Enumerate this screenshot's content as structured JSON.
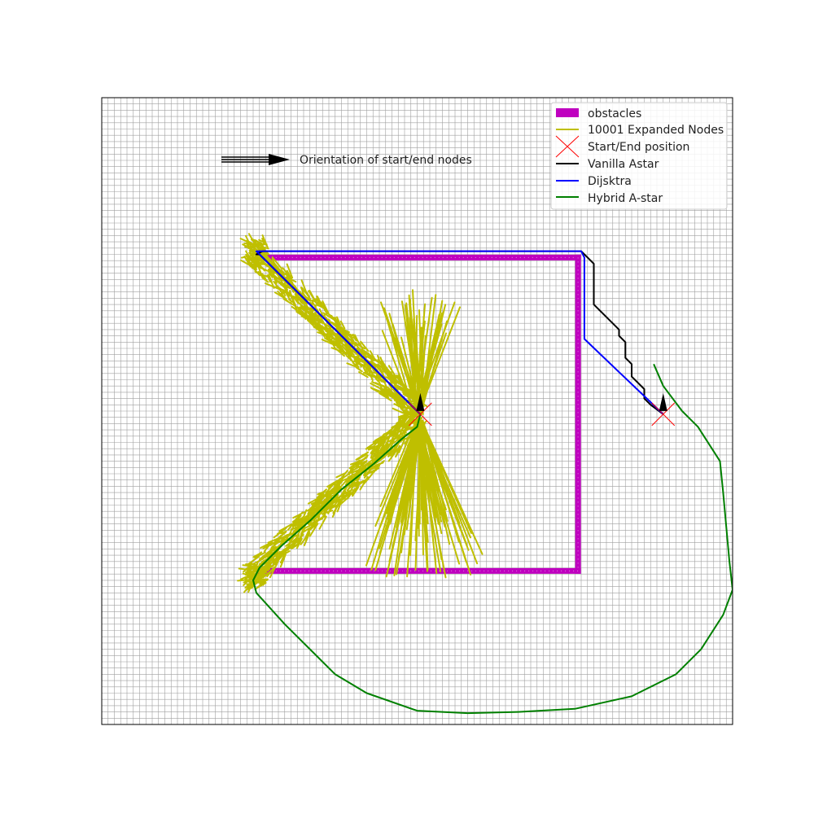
{
  "chart_data": {
    "type": "line",
    "title": "",
    "xlabel": "",
    "ylabel": "",
    "xlim": [
      0,
      100
    ],
    "ylim": [
      0,
      100
    ],
    "grid": true,
    "grid_color": "#a0a0a0",
    "grid_step": 1,
    "legend_position": "top-right",
    "annotation": {
      "text": "Orientation of start/end nodes"
    },
    "start": [
      50.5,
      49.5
    ],
    "end": [
      89,
      49.5
    ],
    "obstacles": [
      [
        [
          25,
          74.5
        ],
        [
          75.5,
          74.5
        ]
      ],
      [
        [
          75.5,
          74.5
        ],
        [
          75.5,
          24.5
        ]
      ],
      [
        [
          75.5,
          24.5
        ],
        [
          25,
          24.5
        ]
      ]
    ],
    "series": [
      {
        "name": "obstacles",
        "color": "#bf00bf",
        "kind": "obstacle"
      },
      {
        "name": "10001 Expanded Nodes",
        "color": "#bfbf00",
        "kind": "expanded"
      },
      {
        "name": "Start/End position",
        "color": "#ff0000",
        "kind": "marker"
      },
      {
        "name": "Vanilla Astar",
        "color": "#000000",
        "kind": "line",
        "points": [
          [
            50.5,
            49.5
          ],
          [
            25,
            75
          ],
          [
            24.5,
            75
          ],
          [
            25.5,
            75.5
          ],
          [
            76,
            75.5
          ],
          [
            78,
            73.5
          ],
          [
            78,
            67
          ],
          [
            82,
            63
          ],
          [
            82,
            62
          ],
          [
            83,
            61
          ],
          [
            83,
            58.5
          ],
          [
            84,
            57.5
          ],
          [
            84,
            55.5
          ],
          [
            86,
            53.5
          ],
          [
            86,
            52
          ],
          [
            87,
            51
          ],
          [
            89,
            49.5
          ]
        ]
      },
      {
        "name": "Dijsktra",
        "color": "#0000ff",
        "kind": "line",
        "points": [
          [
            50.5,
            49.5
          ],
          [
            24.5,
            75.5
          ],
          [
            25.5,
            75.5
          ],
          [
            76,
            75.5
          ],
          [
            76.5,
            74.5
          ],
          [
            76.5,
            61.5
          ],
          [
            89,
            49.5
          ]
        ]
      },
      {
        "name": "Hybrid A-star",
        "color": "#008000",
        "kind": "line",
        "points": [
          [
            50.5,
            49.5
          ],
          [
            50,
            47.5
          ],
          [
            47.5,
            45.5
          ],
          [
            43,
            41.5
          ],
          [
            38,
            37.5
          ],
          [
            33,
            32.5
          ],
          [
            28.5,
            28.5
          ],
          [
            25,
            25
          ],
          [
            24,
            23
          ],
          [
            24.5,
            21
          ],
          [
            29,
            16
          ],
          [
            37,
            8
          ],
          [
            42,
            5
          ],
          [
            50,
            2.2
          ],
          [
            58,
            1.8
          ],
          [
            66,
            2
          ],
          [
            75,
            2.5
          ],
          [
            84,
            4.5
          ],
          [
            91,
            8
          ],
          [
            95,
            12
          ],
          [
            98.5,
            17.5
          ],
          [
            100,
            21.5
          ],
          [
            99.5,
            26
          ],
          [
            98.5,
            37
          ],
          [
            98,
            42
          ],
          [
            94.5,
            47.5
          ],
          [
            92,
            50
          ],
          [
            89,
            54
          ],
          [
            87.5,
            57.5
          ]
        ]
      }
    ]
  }
}
